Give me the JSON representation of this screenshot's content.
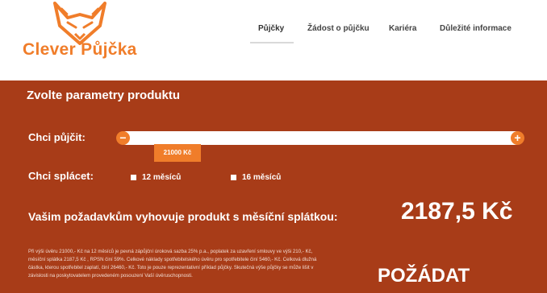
{
  "brand": {
    "logo_text": "Clever Půjčka",
    "accent_color": "#f07d2a",
    "panel_color": "#a83c18",
    "logo_icon": "fox-icon"
  },
  "nav": {
    "items": [
      {
        "label": "Půjčky"
      },
      {
        "label": "Žádost o půjčku"
      },
      {
        "label": "Kariéra"
      },
      {
        "label": "Důležité informace"
      }
    ],
    "active_index": 0
  },
  "form": {
    "title": "Zvolte parametry produktu",
    "borrow_label": "Chci půjčit:",
    "borrow_value": "21000 Kč",
    "minus_label": "−",
    "plus_label": "+",
    "repay_label": "Chci splácet:",
    "options": [
      {
        "label": "12 měsíců",
        "checked": false
      },
      {
        "label": "16 měsíců",
        "checked": false
      }
    ]
  },
  "result": {
    "text": "Vašim požadavkům vyhovuje produkt s měsíční splátkou:",
    "amount": "2187,5 Kč"
  },
  "disclaimer": "Při výši úvěru 21000,- Kč na 12 měsíců je pevná zápůjční úroková sazba 25% p.a., poplatek za uzavření smlouvy ve výši 210,- Kč, měsíční splátka 2187,5 Kč , RPSN činí 59%. Celkové náklady spotřebitelského úvěru pro spotřebitele činí 5460,- Kč. Celková dlužná částka, kterou spotřebitel zaplatí, činí 26460,- Kč. Toto je pouze reprezentativní příklad půjčky. Skutečná výše půjčky se může lišit v závislosti na poskytovatelem provedeném posouzení Vaší úvěruschopnosti.",
  "cta": {
    "label": "POŽÁDAT"
  }
}
